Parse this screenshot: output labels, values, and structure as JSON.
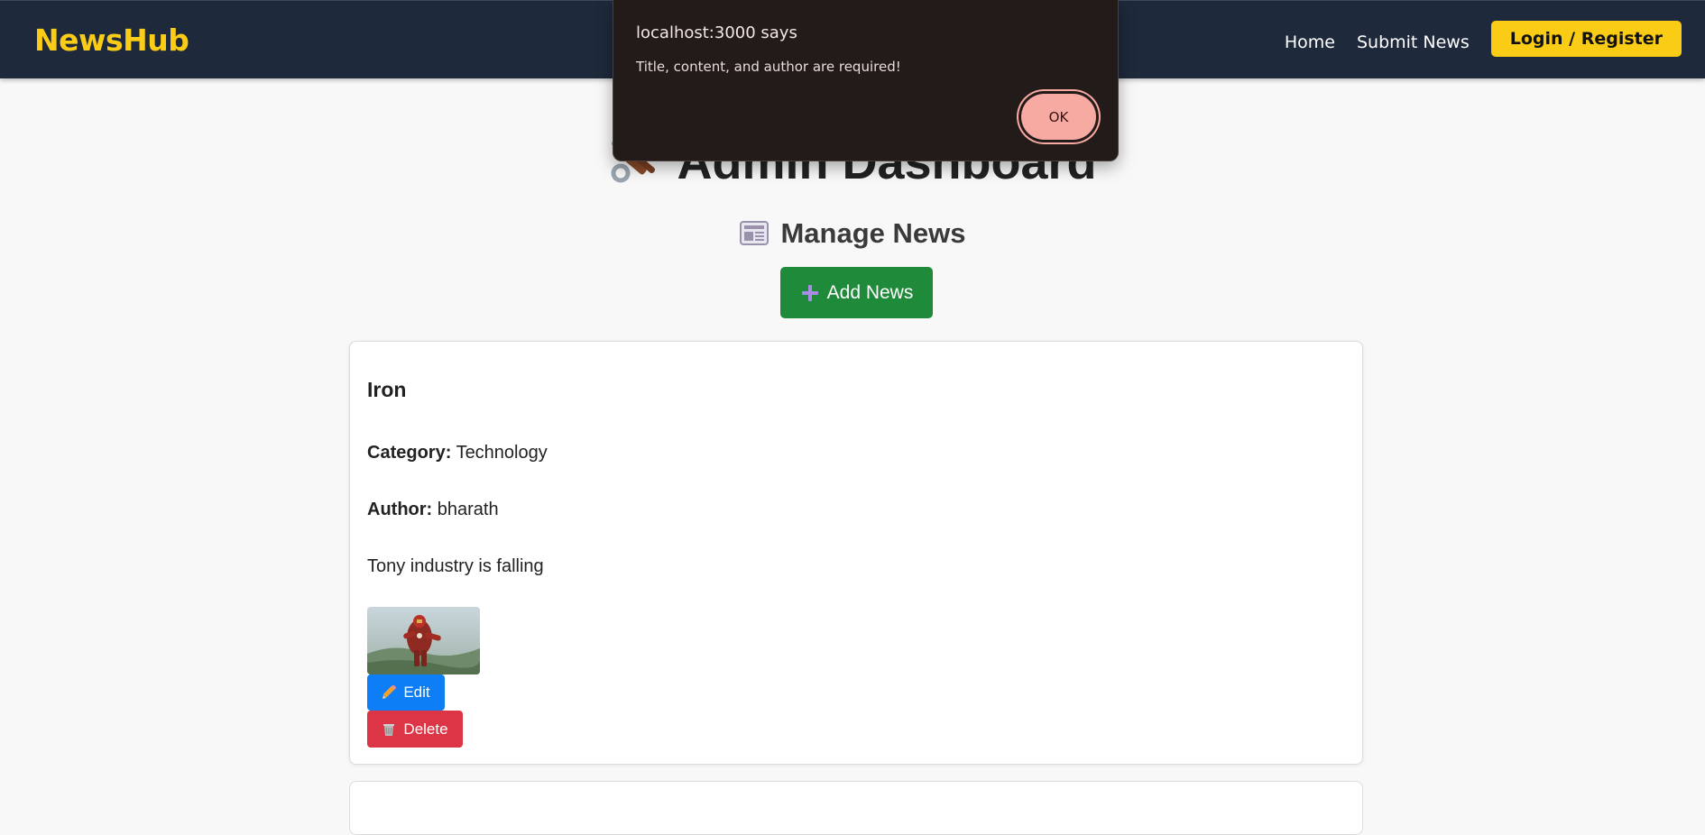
{
  "navbar": {
    "brand": "NewsHub",
    "links": [
      "Home",
      "Submit News"
    ],
    "login_label": "Login / Register"
  },
  "main": {
    "page_title": "Admin Dashboard",
    "section_title": "Manage News",
    "add_button_label": "Add News"
  },
  "news": [
    {
      "title": "Iron",
      "category_label": "Category:",
      "category": "Technology",
      "author_label": "Author:",
      "author": "bharath",
      "content": "Tony industry is falling",
      "edit_label": "Edit",
      "delete_label": "Delete"
    }
  ],
  "dialog": {
    "title": "localhost:3000 says",
    "message": "Title, content, and author are required!",
    "ok_label": "OK"
  },
  "icons": {
    "page_title": "hammer-and-wrench-icon",
    "section_title": "newspaper-icon",
    "add": "plus-icon",
    "edit": "pencil-icon",
    "delete": "wastebasket-icon"
  },
  "colors": {
    "navbar_bg": "#1e293b",
    "brand": "#facc15",
    "login_btn": "#facc15",
    "add_btn": "#1f8a3a",
    "edit_btn": "#0d7ef5",
    "delete_btn": "#dc3545",
    "dialog_bg": "#231a1a",
    "dialog_ok": "#f7aaa2"
  }
}
